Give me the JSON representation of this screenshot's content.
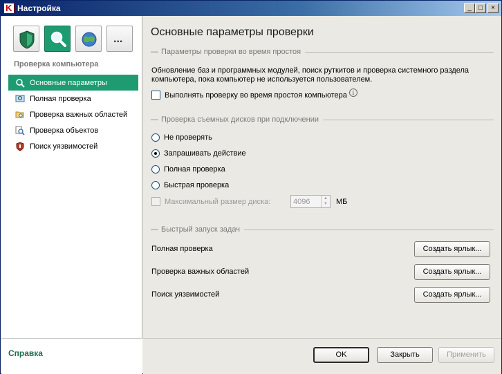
{
  "window": {
    "title": "Настройка",
    "controls": [
      "_",
      "□",
      "×"
    ]
  },
  "sidebar": {
    "categories": [
      {
        "icon": "shield-icon"
      },
      {
        "icon": "magnifier-icon",
        "active": true
      },
      {
        "icon": "globe-icon"
      },
      {
        "icon": "more-icon",
        "label": "..."
      }
    ],
    "heading": "Проверка компьютера",
    "items": [
      {
        "label": "Основные параметры",
        "icon": "magnifier-icon",
        "selected": true
      },
      {
        "label": "Полная проверка",
        "icon": "scan-monitor-icon"
      },
      {
        "label": "Проверка важных областей",
        "icon": "folder-scan-icon"
      },
      {
        "label": "Проверка объектов",
        "icon": "objects-scan-icon"
      },
      {
        "label": "Поиск уязвимостей",
        "icon": "vulnerability-shield-icon"
      }
    ],
    "help": "Справка"
  },
  "main": {
    "title": "Основные параметры проверки",
    "idle_group": {
      "title": "Параметры проверки во время простоя",
      "description": "Обновление баз и программных модулей, поиск руткитов и проверка системного раздела компьютера, пока компьютер не используется пользователем.",
      "checkbox_label": "Выполнять проверку во время простоя компьютера",
      "checked": false
    },
    "removable_group": {
      "title": "Проверка съемных дисков при подключении",
      "options": [
        "Не проверять",
        "Запрашивать действие",
        "Полная проверка",
        "Быстрая проверка"
      ],
      "selected_index": 1,
      "max_size_label": "Максимальный размер диска:",
      "max_size_value": "4096",
      "max_size_unit": "МБ"
    },
    "quick_launch": {
      "title": "Быстрый запуск задач",
      "tasks": [
        {
          "label": "Полная проверка",
          "button": "Создать ярлык..."
        },
        {
          "label": "Проверка важных областей",
          "button": "Создать ярлык..."
        },
        {
          "label": "Поиск уязвимостей",
          "button": "Создать ярлык..."
        }
      ]
    }
  },
  "footer": {
    "ok": "OK",
    "close": "Закрыть",
    "apply": "Применить"
  },
  "colors": {
    "accent": "#1f9b72",
    "title_bar": "#0a246a"
  }
}
